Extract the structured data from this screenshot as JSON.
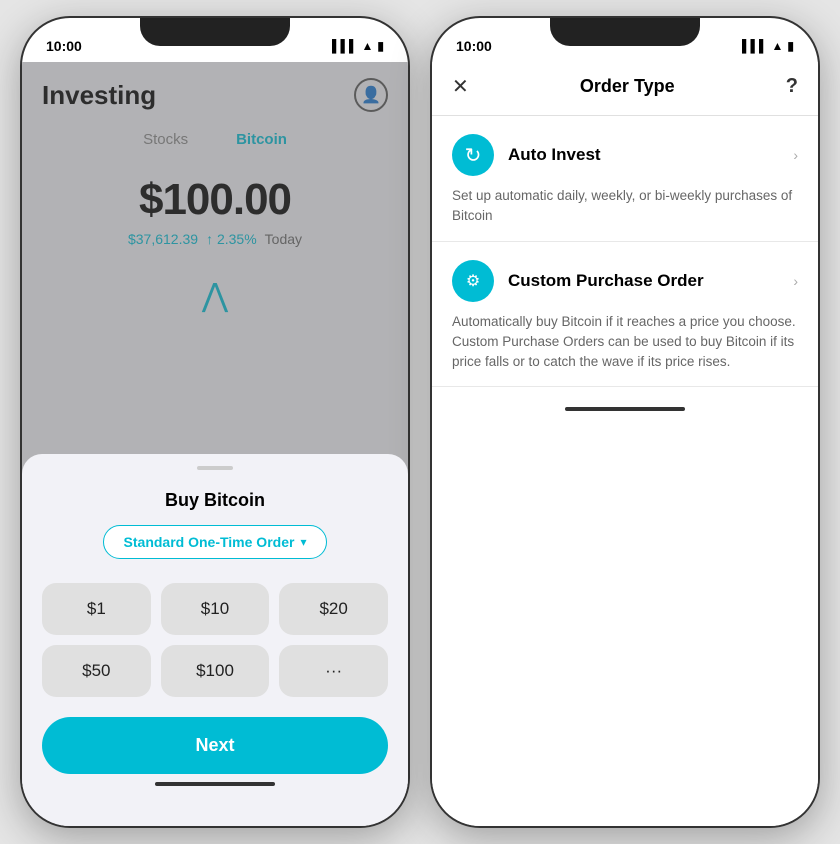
{
  "left_phone": {
    "status_time": "10:00",
    "header_title": "Investing",
    "tab_stocks": "Stocks",
    "tab_bitcoin": "Bitcoin",
    "main_price": "$100.00",
    "current_price": "$37,612.39",
    "price_change": "↑ 2.35%",
    "price_period": "Today",
    "sheet_title": "Buy Bitcoin",
    "order_type_label": "Standard One-Time Order",
    "amounts": [
      "$1",
      "$10",
      "$20",
      "$50",
      "$100",
      "···"
    ],
    "next_button": "Next"
  },
  "right_phone": {
    "status_time": "10:00",
    "header_title": "Order Type",
    "close_label": "✕",
    "help_label": "?",
    "options": [
      {
        "icon": "↻",
        "name": "Auto Invest",
        "description": "Set up automatic daily, weekly, or bi-weekly purchases of Bitcoin"
      },
      {
        "icon": "⚙",
        "name": "Custom Purchase Order",
        "description": "Automatically buy Bitcoin if it reaches a price you choose. Custom Purchase Orders can be used to buy Bitcoin if its price falls or to catch the wave if its price rises."
      }
    ]
  }
}
